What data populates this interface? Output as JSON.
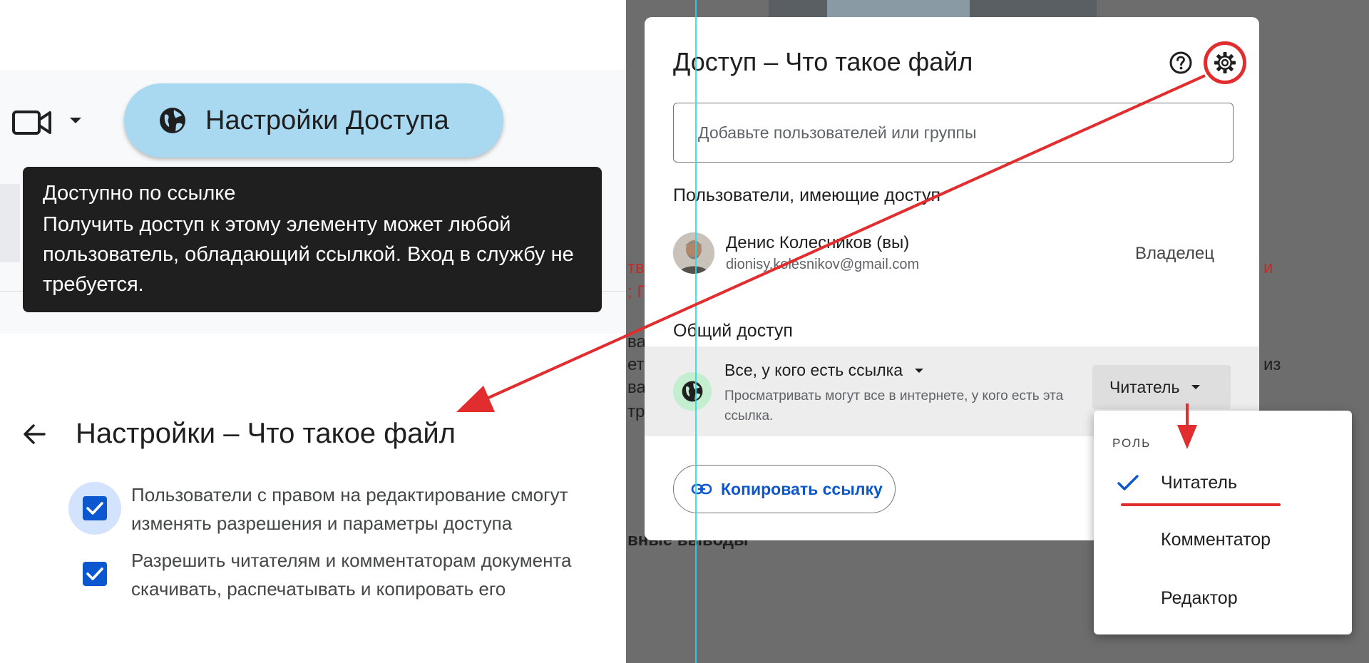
{
  "toolbar": {
    "access_button_label": "Настройки Доступа"
  },
  "tooltip": {
    "title": "Доступно по ссылке",
    "body": "Получить доступ к этому элементу может любой пользователь, обладающий ссылкой. Вход в службу не требуется."
  },
  "settings": {
    "title": "Настройки – Что такое файл",
    "options": [
      {
        "label": "Пользователи с правом на редактирование смогут изменять разрешения и параметры доступа",
        "checked": true
      },
      {
        "label": "Разрешить читателям и комментаторам документа скачивать, распечатывать и копировать его",
        "checked": true
      }
    ]
  },
  "dialog": {
    "title": "Доступ – Что такое файл",
    "add_placeholder": "Добавьте пользователей или группы",
    "people_heading": "Пользователи, имеющие доступ",
    "user": {
      "name": "Денис Колесников (вы)",
      "email": "dionisy.kolesnikov@gmail.com",
      "role": "Владелец"
    },
    "general_heading": "Общий доступ",
    "general": {
      "scope": "Все, у кого есть ссылка",
      "description": "Просматривать могут все в интернете, у кого есть эта ссылка.",
      "role": "Читатель"
    },
    "copy_link_label": "Копировать ссылку"
  },
  "role_menu": {
    "heading": "РОЛЬ",
    "items": [
      "Читатель",
      "Комментатор",
      "Редактор"
    ],
    "selected": "Читатель"
  },
  "background_fragments": {
    "left_red_1": "тв",
    "left_red_2": "; Г",
    "right_red": "и",
    "left_dark_1": "ва",
    "left_dark_2": "ет",
    "left_dark_3": "ва",
    "left_dark_4": "тр",
    "right_dark": "из",
    "bottom": "вные выводы"
  },
  "colors": {
    "accent_blue": "#0b57d0",
    "access_button": "#a8d9f1",
    "annotation_red": "#e12d2d",
    "globe_badge": "#c4eed0"
  }
}
